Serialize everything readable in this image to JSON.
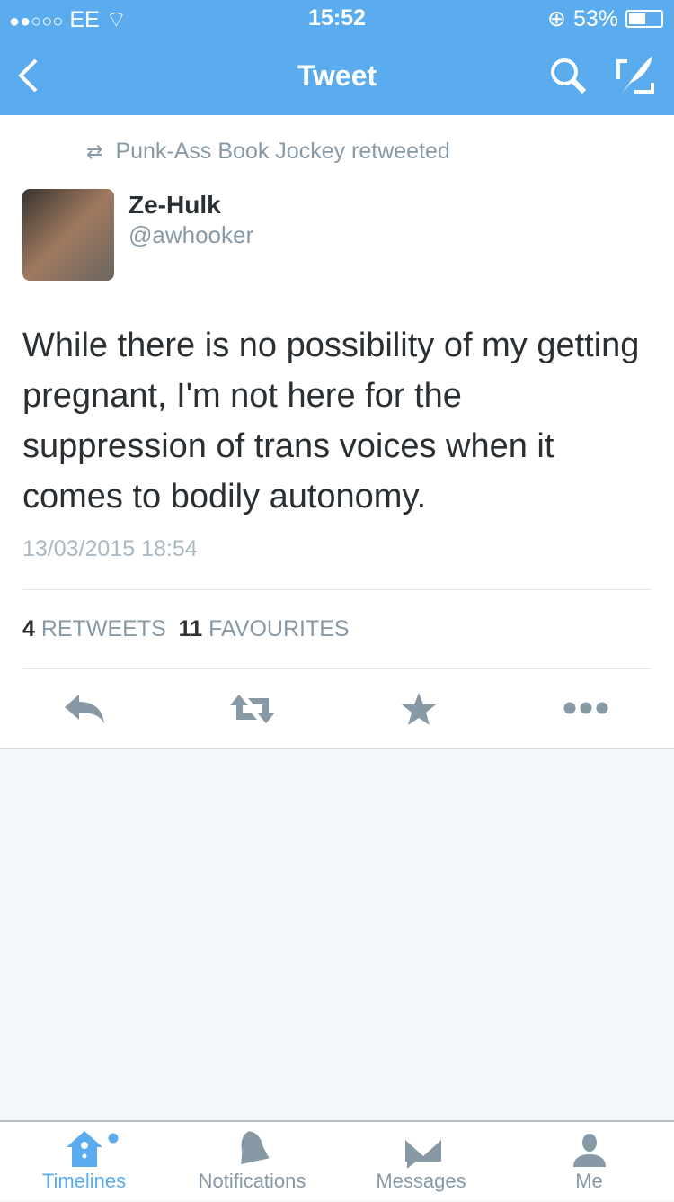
{
  "status_bar": {
    "carrier": "EE",
    "signal": "●●○○○",
    "time": "15:52",
    "battery": "53%",
    "battery_level": 0.53
  },
  "nav": {
    "title": "Tweet"
  },
  "tweet": {
    "retweeted_by": "Punk-Ass Book Jockey retweeted",
    "name": "Ze-Hulk",
    "handle": "@awhooker",
    "text": "While there is no possibility of my getting pregnant, I'm not here for the suppression of trans voices when it comes to bodily autonomy.",
    "timestamp": "13/03/2015 18:54",
    "retweets_count": "4",
    "retweets_label": "RETWEETS",
    "favourites_count": "11",
    "favourites_label": "FAVOURITES"
  },
  "tabs": [
    {
      "label": "Timelines",
      "active": true
    },
    {
      "label": "Notifications"
    },
    {
      "label": "Messages"
    },
    {
      "label": "Me"
    }
  ],
  "colors": {
    "brand": "#5aacee",
    "icon_gray": "#8899a6"
  }
}
